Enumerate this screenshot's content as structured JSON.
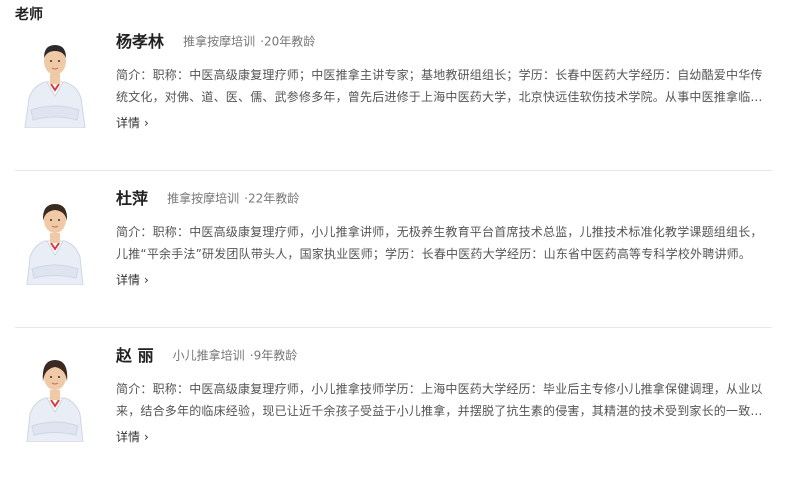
{
  "section": {
    "title": "老师"
  },
  "teachers": [
    {
      "name": "杨孝林",
      "course": "推拿按摩培训",
      "years": "·20年教龄",
      "bio": "简介：职称：中医高级康复理疗师；中医推拿主讲专家；基地教研组组长；学历：长春中医药大学经历：自幼酷爱中华传统文化，对佛、道、医、儒、武参修多年，曾先后进修于上海中医药大学，北京快远佳软伤技术学院。从事中医推拿临床与教学多年。",
      "more": "详情"
    },
    {
      "name": "杜萍",
      "course": "推拿按摩培训",
      "years": "·22年教龄",
      "bio": "简介：职称：中医高级康复理疗师，小儿推拿讲师，无极养生教育平台首席技术总监，儿推技术标准化教学课题组组长，儿推“平余手法”研发团队带头人，国家执业医师；学历：长春中医药大学经历：山东省中医药高等专科学校外聘讲师。",
      "more": "详情"
    },
    {
      "name": "赵 丽",
      "course": "小儿推拿培训",
      "years": "·9年教龄",
      "bio": "简介：职称：中医高级康复理疗师，小儿推拿技师学历：上海中医药大学经历：毕业后主专修小儿推拿保健调理，从业以来，结合多年的临床经验，现已让近千余孩子受益于小儿推拿，并摆脱了抗生素的侵害，其精湛的技术受到家长的一致好评。",
      "more": "详情"
    }
  ],
  "colors": {
    "coat": "#e9edf5",
    "coat_shade": "#cfd6e4",
    "collar_accent": "#d83a3a",
    "skin": "#f0c9a6",
    "hair_male": "#2b2b2b",
    "hair_female": "#3a2a22",
    "divider": "#e8e8e8"
  },
  "icons": {
    "chevron": "chevron-right-icon"
  }
}
